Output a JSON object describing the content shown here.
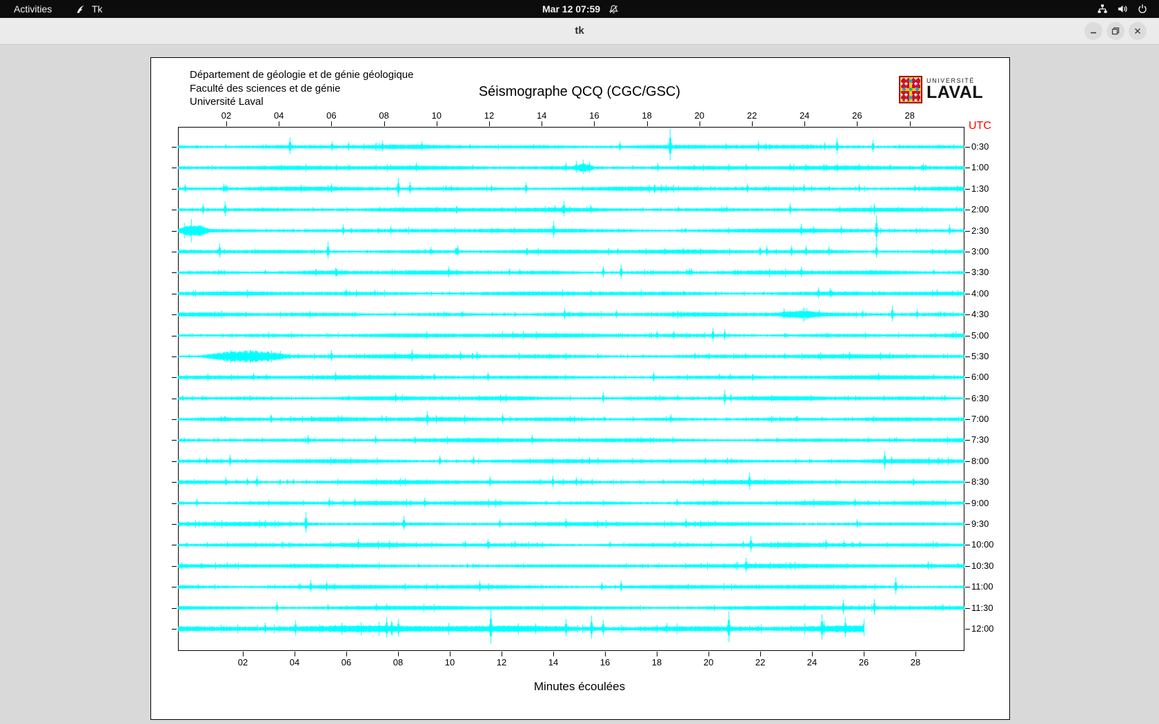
{
  "top_bar": {
    "activities_label": "Activities",
    "app_menu_label": "Tk",
    "clock": "Mar 12 07:59"
  },
  "title_bar": {
    "title": "tk",
    "buttons": [
      "minimize",
      "restore",
      "close"
    ]
  },
  "seismograph": {
    "institution_lines": [
      "Département de géologie et de génie géologique",
      "Faculté des sciences et de génie",
      "Université Laval"
    ],
    "title": "Séismographe QCQ (CGC/GSC)",
    "logo": {
      "top": "UNIVERSITÉ",
      "bottom": "LAVAL"
    },
    "utc_label": "UTC",
    "x_axis_label": "Minutes écoulées",
    "x_ticks": [
      "02",
      "04",
      "06",
      "08",
      "10",
      "12",
      "14",
      "16",
      "18",
      "20",
      "22",
      "24",
      "26",
      "28"
    ],
    "y_labels": [
      "0:30",
      "1:00",
      "1:30",
      "2:00",
      "2:30",
      "3:00",
      "3:30",
      "4:00",
      "4:30",
      "5:00",
      "5:30",
      "6:00",
      "6:30",
      "7:00",
      "7:30",
      "8:00",
      "8:30",
      "9:00",
      "9:30",
      "10:00",
      "10:30",
      "11:00",
      "11:30",
      "12:00"
    ],
    "trace_color": "#00ffff",
    "utc_color": "#ff0000",
    "row_count": 24,
    "last_row_fraction": 0.873,
    "row_gains": {
      "23": 1.6
    },
    "spikes": [
      [
        0,
        0.142,
        14
      ],
      [
        0,
        0.196,
        8
      ],
      [
        0,
        0.26,
        9
      ],
      [
        0,
        0.625,
        26
      ],
      [
        0,
        0.838,
        13
      ],
      [
        0,
        0.883,
        10
      ],
      [
        1,
        0.506,
        10
      ],
      [
        1,
        0.515,
        12
      ],
      [
        1,
        0.523,
        9
      ],
      [
        1,
        0.61,
        7
      ],
      [
        1,
        0.866,
        6
      ],
      [
        2,
        0.009,
        7
      ],
      [
        2,
        0.195,
        8
      ],
      [
        2,
        0.28,
        16
      ],
      [
        2,
        0.295,
        10
      ],
      [
        2,
        0.398,
        6
      ],
      [
        2,
        0.724,
        8
      ],
      [
        2,
        0.796,
        7
      ],
      [
        3,
        0.06,
        12
      ],
      [
        3,
        0.49,
        13
      ],
      [
        3,
        0.885,
        9
      ],
      [
        4,
        0.21,
        9
      ],
      [
        4,
        0.27,
        7
      ],
      [
        4,
        0.477,
        14
      ],
      [
        4,
        0.792,
        10
      ],
      [
        4,
        0.888,
        22
      ],
      [
        5,
        0.053,
        12
      ],
      [
        5,
        0.19,
        14
      ],
      [
        5,
        0.355,
        9
      ],
      [
        5,
        0.642,
        6
      ],
      [
        5,
        0.888,
        12
      ],
      [
        6,
        0.2,
        7
      ],
      [
        6,
        0.54,
        9
      ],
      [
        6,
        0.563,
        12
      ],
      [
        6,
        0.65,
        6
      ],
      [
        7,
        0.214,
        6
      ],
      [
        7,
        0.814,
        9
      ],
      [
        8,
        0.77,
        9
      ],
      [
        8,
        0.815,
        7
      ],
      [
        8,
        0.908,
        13
      ],
      [
        9,
        0.63,
        7
      ],
      [
        9,
        0.68,
        11
      ],
      [
        9,
        0.695,
        9
      ],
      [
        10,
        0.195,
        9
      ],
      [
        10,
        0.297,
        10
      ],
      [
        10,
        0.38,
        7
      ],
      [
        11,
        0.604,
        8
      ],
      [
        11,
        0.89,
        7
      ],
      [
        12,
        0.54,
        9
      ],
      [
        12,
        0.695,
        12
      ],
      [
        13,
        0.317,
        12
      ],
      [
        13,
        0.787,
        5
      ],
      [
        15,
        0.898,
        15
      ],
      [
        16,
        0.726,
        14
      ],
      [
        18,
        0.162,
        17
      ],
      [
        18,
        0.287,
        12
      ],
      [
        18,
        0.646,
        8
      ],
      [
        19,
        0.728,
        13
      ],
      [
        20,
        0.722,
        12
      ],
      [
        21,
        0.168,
        10
      ],
      [
        21,
        0.563,
        9
      ],
      [
        21,
        0.912,
        14
      ],
      [
        22,
        0.125,
        8
      ],
      [
        22,
        0.846,
        12
      ],
      [
        22,
        0.885,
        13
      ],
      [
        23,
        0.265,
        11
      ],
      [
        23,
        0.28,
        9
      ],
      [
        23,
        0.397,
        18
      ],
      [
        23,
        0.493,
        9
      ],
      [
        23,
        0.525,
        12
      ],
      [
        23,
        0.54,
        8
      ],
      [
        23,
        0.7,
        16
      ],
      [
        23,
        0.818,
        13
      ],
      [
        23,
        0.848,
        10
      ]
    ],
    "bursts": [
      [
        10,
        0.028,
        0.115,
        7
      ],
      [
        4,
        0.0,
        0.04,
        6
      ],
      [
        1,
        0.5,
        0.03,
        4
      ],
      [
        8,
        0.76,
        0.06,
        3
      ]
    ]
  }
}
